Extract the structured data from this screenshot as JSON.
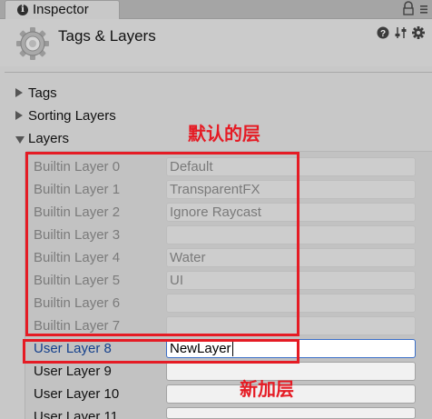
{
  "tab": {
    "title": "Inspector",
    "icon": "info-icon"
  },
  "header": {
    "title": "Tags & Layers",
    "icon": "settings-gear-icon"
  },
  "sections": {
    "tags": "Tags",
    "sorting_layers": "Sorting Layers",
    "layers": "Layers"
  },
  "layers": [
    {
      "label": "Builtin Layer 0",
      "value": "Default",
      "kind": "builtin"
    },
    {
      "label": "Builtin Layer 1",
      "value": "TransparentFX",
      "kind": "builtin"
    },
    {
      "label": "Builtin Layer 2",
      "value": "Ignore Raycast",
      "kind": "builtin"
    },
    {
      "label": "Builtin Layer 3",
      "value": "",
      "kind": "builtin"
    },
    {
      "label": "Builtin Layer 4",
      "value": "Water",
      "kind": "builtin"
    },
    {
      "label": "Builtin Layer 5",
      "value": "UI",
      "kind": "builtin"
    },
    {
      "label": "Builtin Layer 6",
      "value": "",
      "kind": "builtin"
    },
    {
      "label": "Builtin Layer 7",
      "value": "",
      "kind": "builtin"
    },
    {
      "label": "User Layer 8",
      "value": "NewLayer",
      "kind": "active"
    },
    {
      "label": "User Layer 9",
      "value": "",
      "kind": "user"
    },
    {
      "label": "User Layer 10",
      "value": "",
      "kind": "user"
    },
    {
      "label": "User Layer 11",
      "value": "",
      "kind": "user"
    }
  ],
  "annotations": {
    "default_layers": "默认的层",
    "new_layer": "新加层"
  },
  "colors": {
    "annotation": "#e51b24",
    "selected_label": "#15418c",
    "focus_border": "#3b6fc8"
  }
}
